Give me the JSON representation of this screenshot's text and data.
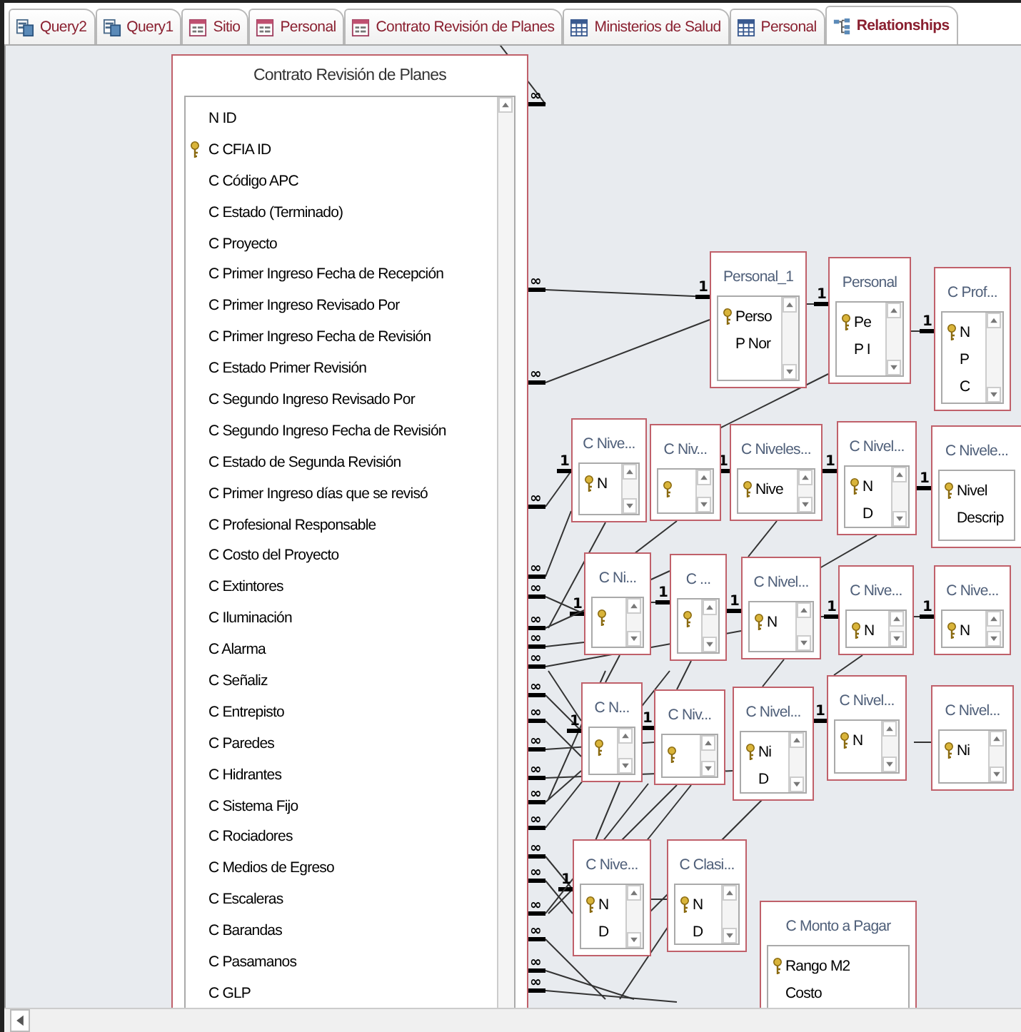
{
  "tabs": [
    {
      "label": "Query2",
      "kind": "query",
      "selected": false
    },
    {
      "label": "Query1",
      "kind": "query",
      "selected": false
    },
    {
      "label": "Sitio",
      "kind": "form",
      "selected": false
    },
    {
      "label": "Personal",
      "kind": "form",
      "selected": false
    },
    {
      "label": "Contrato Revisión de Planes",
      "kind": "form",
      "selected": false
    },
    {
      "label": "Ministerios de Salud",
      "kind": "table",
      "selected": false
    },
    {
      "label": "Personal",
      "kind": "table",
      "selected": false
    },
    {
      "label": "Relationships",
      "kind": "relationships",
      "selected": true
    }
  ],
  "tables": [
    {
      "title": "Contrato Revisión de Planes",
      "fields": [
        {
          "name": "N ID",
          "key": false
        },
        {
          "name": "C CFIA ID",
          "key": true
        },
        {
          "name": "C Código APC",
          "key": false
        },
        {
          "name": "C Estado (Terminado)",
          "key": false
        },
        {
          "name": "C Proyecto",
          "key": false
        },
        {
          "name": "C Primer Ingreso Fecha de Recepción",
          "key": false
        },
        {
          "name": "C Primer Ingreso Revisado Por",
          "key": false
        },
        {
          "name": "C Primer Ingreso Fecha de Revisión",
          "key": false
        },
        {
          "name": "C Estado Primer Revisión",
          "key": false
        },
        {
          "name": "C Segundo Ingreso Revisado Por",
          "key": false
        },
        {
          "name": "C Segundo Ingreso Fecha de Revisión",
          "key": false
        },
        {
          "name": "C Estado de Segunda Revisión",
          "key": false
        },
        {
          "name": "C Primer Ingreso días que se revisó",
          "key": false
        },
        {
          "name": "C Profesional Responsable",
          "key": false
        },
        {
          "name": "C Costo del Proyecto",
          "key": false
        },
        {
          "name": "C Extintores",
          "key": false
        },
        {
          "name": "C Iluminación",
          "key": false
        },
        {
          "name": "C Alarma",
          "key": false
        },
        {
          "name": "C Señaliz",
          "key": false
        },
        {
          "name": "C Entrepisto",
          "key": false
        },
        {
          "name": "C Paredes",
          "key": false
        },
        {
          "name": "C Hidrantes",
          "key": false
        },
        {
          "name": "C Sistema Fijo",
          "key": false
        },
        {
          "name": "C Rociadores",
          "key": false
        },
        {
          "name": "C Medios de Egreso",
          "key": false
        },
        {
          "name": "C Escaleras",
          "key": false
        },
        {
          "name": "C Barandas",
          "key": false
        },
        {
          "name": "C Pasamanos",
          "key": false
        },
        {
          "name": "C GLP",
          "key": false
        }
      ]
    },
    {
      "title": "Personal_1",
      "fields": [
        {
          "name": "Perso",
          "key": true
        },
        {
          "name": "P Nor",
          "key": false
        }
      ]
    },
    {
      "title": "Personal",
      "fields": [
        {
          "name": "Pe",
          "key": true
        },
        {
          "name": "P I",
          "key": false
        }
      ]
    },
    {
      "title": "C Prof...",
      "fields": [
        {
          "name": "N",
          "key": true
        },
        {
          "name": "P",
          "key": false
        },
        {
          "name": "C",
          "key": false
        }
      ]
    },
    {
      "title": "C Nive...",
      "fields": [
        {
          "name": "N",
          "key": true
        }
      ]
    },
    {
      "title": "C Niv...",
      "fields": [
        {
          "key": true
        }
      ]
    },
    {
      "title": "C Niveles...",
      "fields": [
        {
          "name": "Nive",
          "key": true
        }
      ]
    },
    {
      "title": "C Nivel...",
      "fields": [
        {
          "name": "N",
          "key": true
        },
        {
          "name": "D",
          "key": false
        }
      ]
    },
    {
      "title": "C Nivele...",
      "fields": [
        {
          "name": "Nivel",
          "key": true
        },
        {
          "name": "Descrip",
          "key": false
        }
      ]
    },
    {
      "title": "C Ni...",
      "fields": [
        {
          "key": true
        }
      ]
    },
    {
      "title": "C ...",
      "fields": [
        {
          "key": true
        }
      ]
    },
    {
      "title": "C Nivel...",
      "fields": [
        {
          "name": "N",
          "key": true
        }
      ]
    },
    {
      "title": "C Nive...",
      "fields": [
        {
          "name": "N",
          "key": true
        }
      ]
    },
    {
      "title": "C Nive...",
      "fields": [
        {
          "name": "N",
          "key": true
        }
      ]
    },
    {
      "title": "C N...",
      "fields": [
        {
          "key": true
        }
      ]
    },
    {
      "title": "C Niv...",
      "fields": [
        {
          "key": true
        }
      ]
    },
    {
      "title": "C Nivel...",
      "fields": [
        {
          "name": "Ni",
          "key": true
        },
        {
          "name": "D",
          "key": false
        }
      ]
    },
    {
      "title": "C Nivel...",
      "fields": [
        {
          "name": "N",
          "key": true
        }
      ]
    },
    {
      "title": "C Nivel...",
      "fields": [
        {
          "name": "Ni",
          "key": true
        }
      ]
    },
    {
      "title": "C Nive...",
      "fields": [
        {
          "name": "N",
          "key": true
        },
        {
          "name": "D",
          "key": false
        }
      ]
    },
    {
      "title": "C Clasi...",
      "fields": [
        {
          "name": "N",
          "key": true
        },
        {
          "name": "D",
          "key": false
        }
      ]
    },
    {
      "title": "C Monto a Pagar",
      "fields": [
        {
          "name": "Rango M2",
          "key": true
        },
        {
          "name": "Costo",
          "key": false
        }
      ]
    }
  ],
  "relationships": [
    {
      "many": "∞"
    },
    {
      "many": "∞",
      "one": "1"
    },
    {
      "many": "∞"
    },
    {
      "many": "∞",
      "one": "1"
    },
    {
      "many": "∞"
    },
    {
      "many": "∞",
      "one": "1"
    },
    {
      "many": "∞"
    },
    {
      "many": "∞"
    },
    {
      "many": "∞"
    },
    {
      "many": "∞",
      "one": "1"
    },
    {
      "many": "∞"
    },
    {
      "many": "∞"
    },
    {
      "many": "∞"
    },
    {
      "many": "∞"
    },
    {
      "many": "∞"
    },
    {
      "many": "∞",
      "one": "1"
    },
    {
      "many": "∞"
    },
    {
      "many": "∞"
    },
    {
      "many": "∞"
    },
    {
      "many": "∞"
    },
    {
      "many": "∞"
    },
    {
      "one": "1"
    },
    {
      "one": "1"
    },
    {
      "one": "1"
    },
    {
      "one": "1"
    },
    {
      "one": "1"
    },
    {
      "one": "1"
    },
    {
      "one": "1"
    },
    {
      "one": "1"
    },
    {
      "one": "1"
    },
    {
      "one": "1"
    },
    {
      "one": "1"
    }
  ]
}
